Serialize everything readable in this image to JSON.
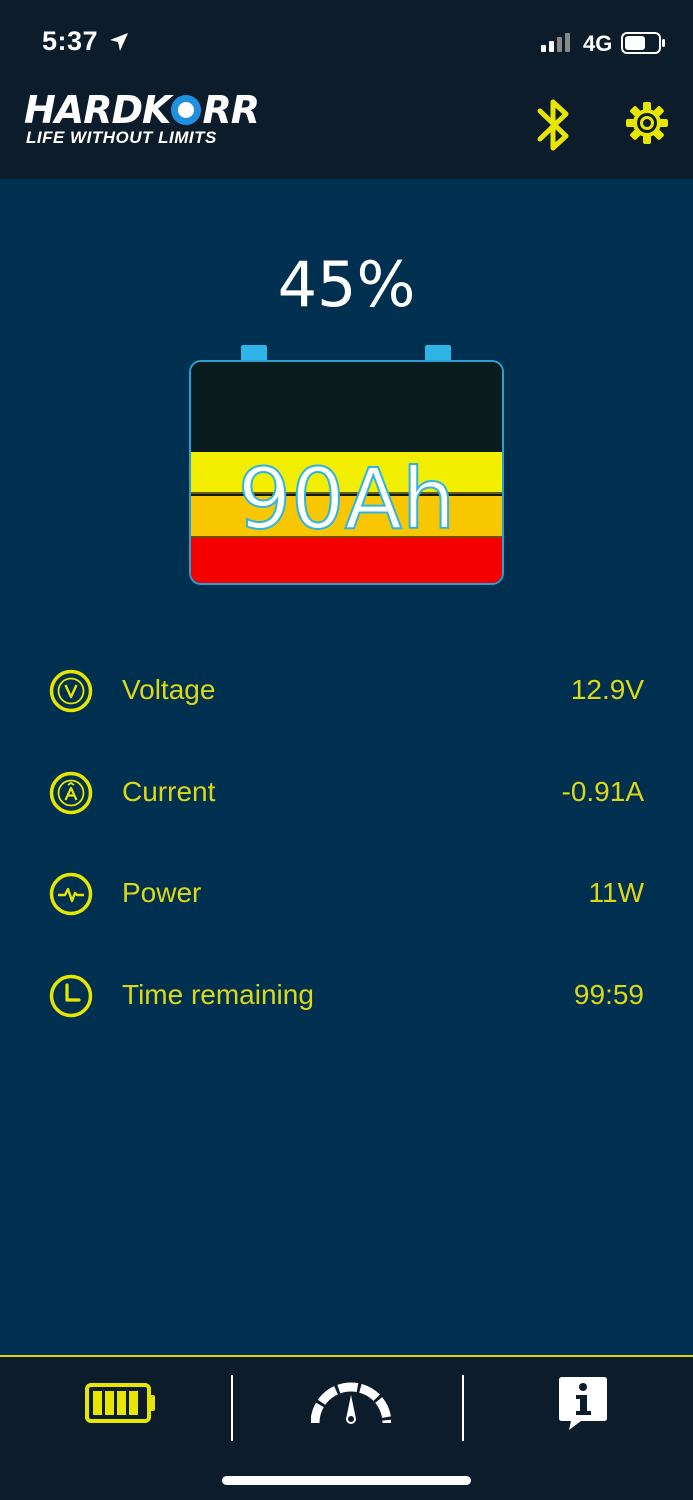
{
  "status_bar": {
    "time": "5:37",
    "network": "4G",
    "location_icon": "location-arrow-icon",
    "signal_icon": "cellular-signal-icon",
    "battery_icon": "status-battery-icon"
  },
  "header": {
    "logo_word_a": "HARDK",
    "logo_word_b": "RR",
    "logo_tagline": "LIFE WITHOUT LIMITS",
    "bluetooth_icon": "bluetooth-icon",
    "settings_icon": "gear-icon"
  },
  "battery": {
    "percent": "45%",
    "capacity": "90Ah"
  },
  "metrics": [
    {
      "icon": "voltage-icon",
      "label": "Voltage",
      "value": "12.9V"
    },
    {
      "icon": "current-icon",
      "label": "Current",
      "value": "-0.91A"
    },
    {
      "icon": "power-icon",
      "label": "Power",
      "value": "11W"
    },
    {
      "icon": "clock-icon",
      "label": "Time remaining",
      "value": "99:59"
    }
  ],
  "tabs": [
    {
      "icon": "battery-tab-icon"
    },
    {
      "icon": "gauge-icon"
    },
    {
      "icon": "info-icon"
    }
  ],
  "colors": {
    "accent": "#dcd717",
    "background": "#00304f",
    "header": "#0c1c2b",
    "terminal": "#2fb4e8"
  }
}
